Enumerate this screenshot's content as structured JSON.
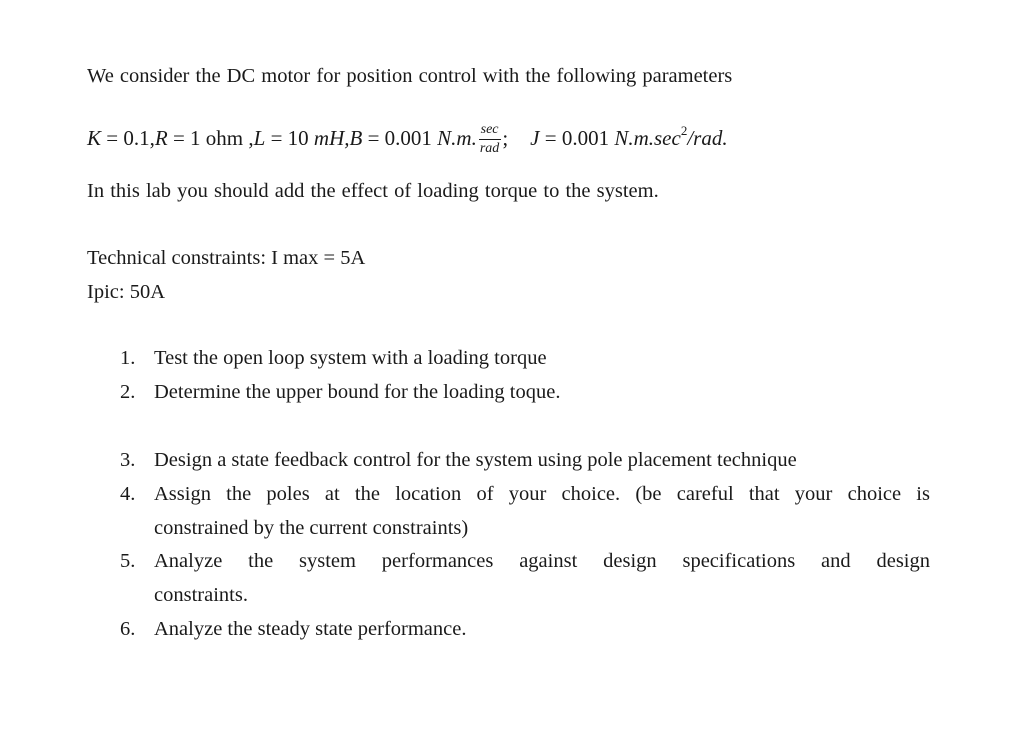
{
  "document": {
    "intro": "We consider the DC motor for position control with the following parameters",
    "equation": {
      "K_var": "K",
      "K_eq": "= 0.1,",
      "R_var": "R",
      "R_eq": "= 1 ohm ,",
      "L_var": "L",
      "L_eq": "= 10",
      "L_unit": "mH,",
      "B_var": "B",
      "B_eq": "= 0.001",
      "B_unit": "N.m.",
      "B_frac_num": "sec",
      "B_frac_den": "rad",
      "B_sep": ";",
      "J_var": "J",
      "J_eq": "= 0.001",
      "J_unit_pre": "N.m.sec",
      "J_unit_sup": "2",
      "J_unit_post": "/rad."
    },
    "lab_statement": "In this lab you should add the effect of loading torque to the system.",
    "technical_constraints": "Technical constraints: I max = 5A",
    "ipic": "Ipic: 50A",
    "tasks": [
      {
        "number": "1.",
        "text": "Test the open loop system with a loading torque"
      },
      {
        "number": "2.",
        "text": "Determine the upper bound for the loading toque."
      },
      {
        "number": "3.",
        "text": "Design a state feedback control for the system using pole placement technique"
      },
      {
        "number": "4.",
        "text": "Assign the poles at the location of your choice.  (be careful that your choice is",
        "continuation": "constrained by the current constraints)"
      },
      {
        "number": "5.",
        "text": "Analyze the system performances against design specifications and design",
        "continuation": "constraints."
      },
      {
        "number": "6.",
        "text": "Analyze the steady state performance."
      }
    ]
  }
}
